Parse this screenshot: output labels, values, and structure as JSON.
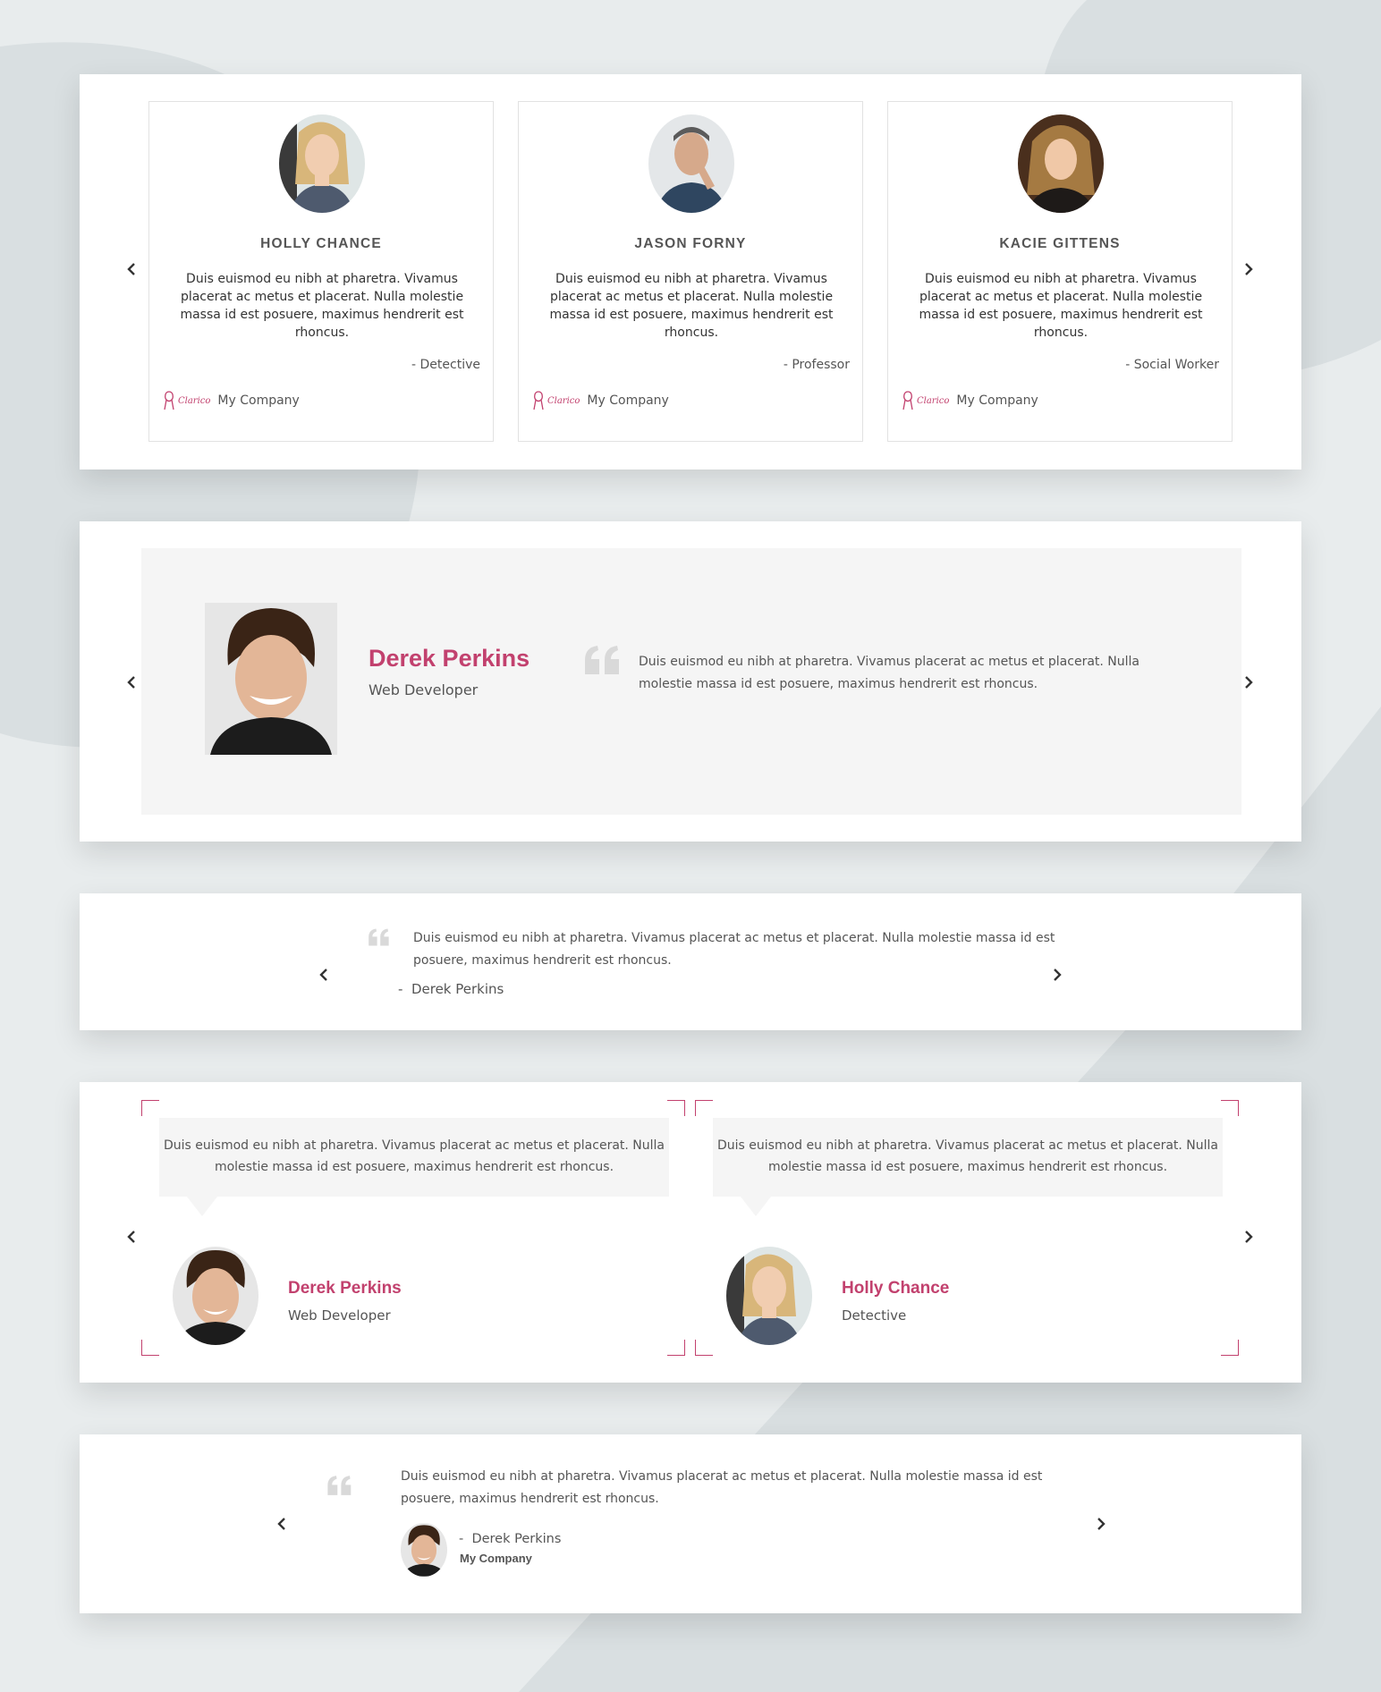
{
  "colors": {
    "accent": "#c2416e",
    "text": "#555555",
    "background": "#e6eaeb"
  },
  "icons": {
    "prev": "chevron-left-icon",
    "next": "chevron-right-icon",
    "quote": "quote-icon"
  },
  "carousel_cards": {
    "items": [
      {
        "name": "HOLLY CHANCE",
        "text": "Duis euismod eu nibh at pharetra. Vivamus placerat ac metus et placerat. Nulla molestie massa id est posuere, maximus hendrerit est rhoncus.",
        "role": "- Detective",
        "logo_text": "Clarico",
        "company": "My Company"
      },
      {
        "name": "JASON FORNY",
        "text": "Duis euismod eu nibh at pharetra. Vivamus placerat ac metus et placerat. Nulla molestie massa id est posuere, maximus hendrerit est rhoncus.",
        "role": "- Professor",
        "logo_text": "Clarico",
        "company": "My Company"
      },
      {
        "name": "KACIE GITTENS",
        "text": "Duis euismod eu nibh at pharetra. Vivamus placerat ac metus et placerat. Nulla molestie massa id est posuere, maximus hendrerit est rhoncus.",
        "role": "- Social Worker",
        "logo_text": "Clarico",
        "company": "My Company"
      }
    ]
  },
  "featured": {
    "name": "Derek Perkins",
    "role": "Web Developer",
    "text": "Duis euismod eu nibh at pharetra. Vivamus placerat ac metus et placerat. Nulla molestie massa id est posuere, maximus hendrerit est rhoncus."
  },
  "simple": {
    "text": "Duis euismod eu nibh at pharetra. Vivamus placerat ac metus et placerat. Nulla molestie massa id est posuere, maximus hendrerit est rhoncus.",
    "author": "-  Derek Perkins"
  },
  "bubbles": {
    "items": [
      {
        "text": "Duis euismod eu nibh at pharetra. Vivamus placerat ac metus et placerat. Nulla molestie massa id est posuere, maximus hendrerit est rhoncus.",
        "name": "Derek Perkins",
        "role": "Web Developer"
      },
      {
        "text": "Duis euismod eu nibh at pharetra. Vivamus placerat ac metus et placerat. Nulla molestie massa id est posuere, maximus hendrerit est rhoncus.",
        "name": "Holly Chance",
        "role": "Detective"
      }
    ]
  },
  "compact": {
    "text": "Duis euismod eu nibh at pharetra. Vivamus placerat ac metus et placerat. Nulla molestie massa id est posuere, maximus hendrerit est rhoncus.",
    "author": "-  Derek Perkins",
    "company": "My Company"
  }
}
